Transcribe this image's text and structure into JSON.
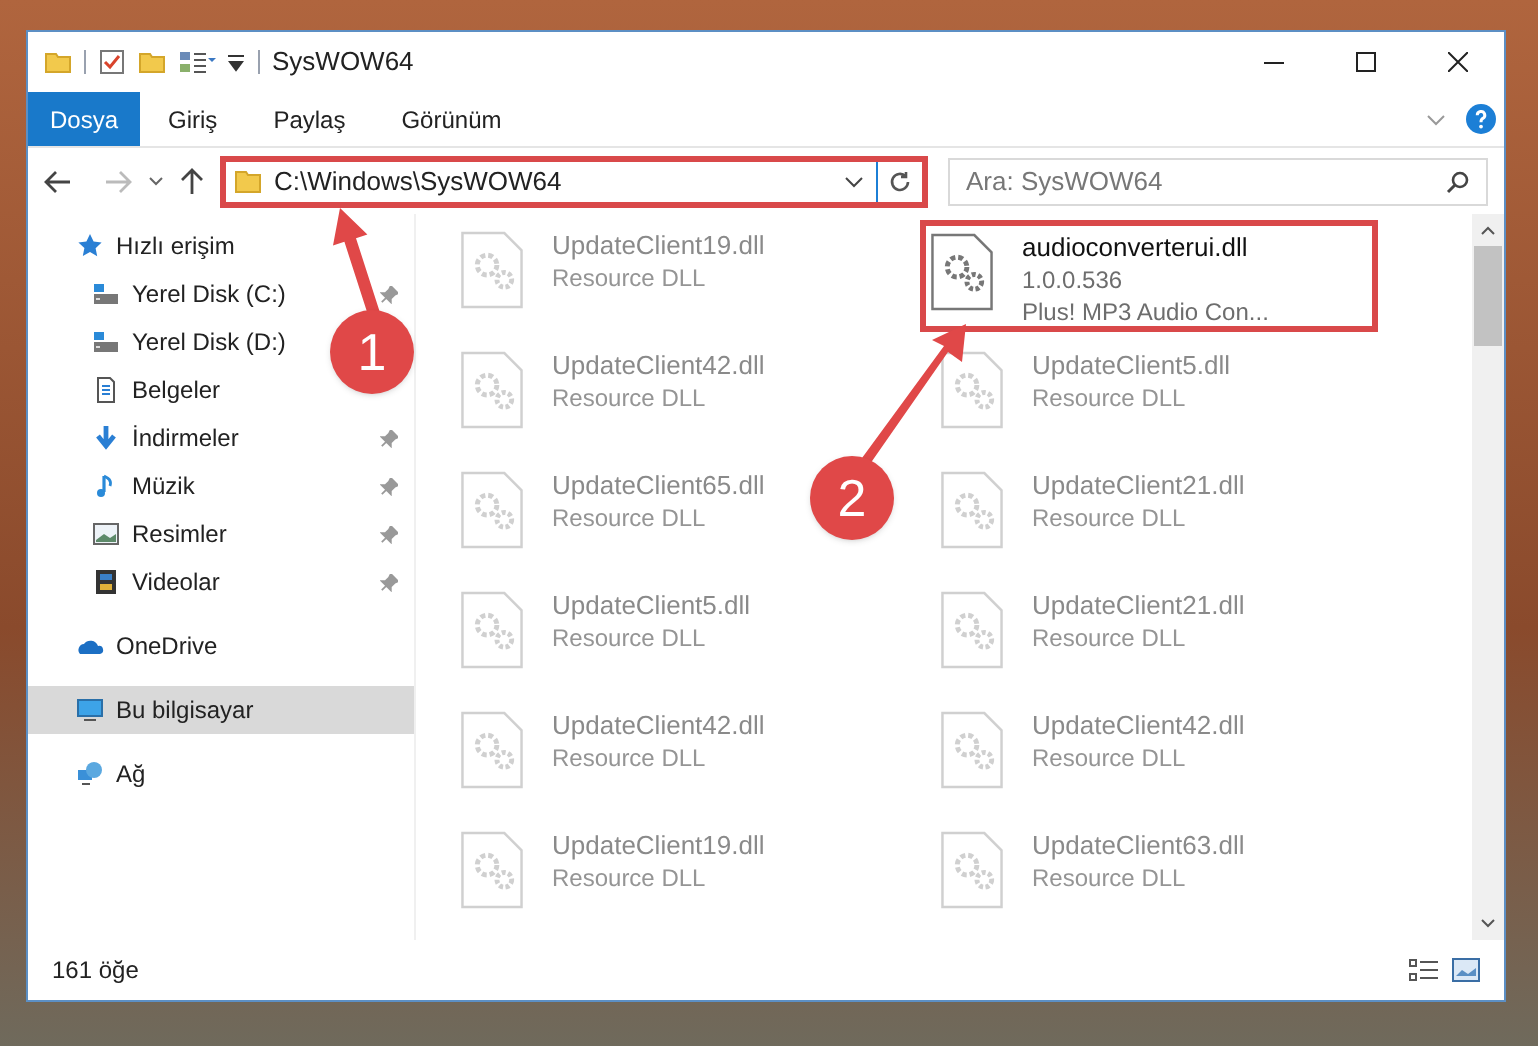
{
  "window": {
    "title": "SysWOW64"
  },
  "ribbon_tabs": [
    {
      "label": "Dosya",
      "selected": true
    },
    {
      "label": "Giriş",
      "selected": false
    },
    {
      "label": "Paylaş",
      "selected": false
    },
    {
      "label": "Görünüm",
      "selected": false
    }
  ],
  "address_bar": {
    "path": "C:\\Windows\\SysWOW64",
    "highlighted": true
  },
  "search": {
    "placeholder": "Ara: SysWOW64"
  },
  "sidebar": {
    "items": [
      {
        "label": "Hızlı erişim",
        "kind": "star",
        "pinned": false,
        "selected": false,
        "children": [
          {
            "label": "Yerel Disk (C:)",
            "kind": "drive",
            "pinned": true,
            "selected": false
          },
          {
            "label": "Yerel Disk (D:)",
            "kind": "drive",
            "pinned": false,
            "selected": false
          },
          {
            "label": "Belgeler",
            "kind": "document",
            "pinned": false,
            "selected": false
          },
          {
            "label": "İndirmeler",
            "kind": "download",
            "pinned": true,
            "selected": false
          },
          {
            "label": "Müzik",
            "kind": "music",
            "pinned": true,
            "selected": false
          },
          {
            "label": "Resimler",
            "kind": "picture",
            "pinned": true,
            "selected": false
          },
          {
            "label": "Videolar",
            "kind": "video",
            "pinned": true,
            "selected": false
          }
        ]
      },
      {
        "label": "OneDrive",
        "kind": "cloud",
        "pinned": false,
        "selected": false
      },
      {
        "label": "Bu bilgisayar",
        "kind": "computer",
        "pinned": false,
        "selected": true
      },
      {
        "label": "Ağ",
        "kind": "network",
        "pinned": false,
        "selected": false
      }
    ]
  },
  "files": [
    {
      "kind": "faded",
      "name": "UpdateClient19.dll",
      "lines": [
        "Resource DLL"
      ]
    },
    {
      "kind": "highlighted",
      "name": "audioconverterui.dll",
      "lines": [
        "1.0.0.536",
        "Plus! MP3 Audio Con..."
      ]
    },
    {
      "kind": "faded",
      "name": "UpdateClient42.dll",
      "lines": [
        "Resource DLL"
      ]
    },
    {
      "kind": "faded",
      "name": "UpdateClient5.dll",
      "lines": [
        "Resource DLL"
      ]
    },
    {
      "kind": "faded",
      "name": "UpdateClient65.dll",
      "lines": [
        "Resource DLL"
      ]
    },
    {
      "kind": "faded",
      "name": "UpdateClient21.dll",
      "lines": [
        "Resource DLL"
      ]
    },
    {
      "kind": "faded",
      "name": "UpdateClient5.dll",
      "lines": [
        "Resource DLL"
      ]
    },
    {
      "kind": "faded",
      "name": "UpdateClient21.dll",
      "lines": [
        "Resource DLL"
      ]
    },
    {
      "kind": "faded",
      "name": "UpdateClient42.dll",
      "lines": [
        "Resource DLL"
      ]
    },
    {
      "kind": "faded",
      "name": "UpdateClient42.dll",
      "lines": [
        "Resource DLL"
      ]
    },
    {
      "kind": "faded",
      "name": "UpdateClient19.dll",
      "lines": [
        "Resource DLL"
      ]
    },
    {
      "kind": "faded",
      "name": "UpdateClient63.dll",
      "lines": [
        "Resource DLL"
      ]
    }
  ],
  "status_bar": {
    "count": "161 öğe"
  },
  "annotations": [
    {
      "label": "1"
    },
    {
      "label": "2"
    }
  ]
}
